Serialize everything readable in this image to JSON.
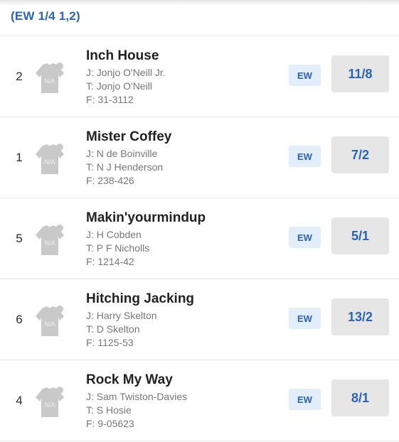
{
  "market": {
    "each_way_terms": "(EW 1/4 1,2)"
  },
  "colors": {
    "accent": "#2a63b7",
    "ew_bg": "#e2eef9",
    "odds_bg": "#e6e6e6",
    "silk": "#c7c7c7"
  },
  "runners": [
    {
      "number": "2",
      "name": "Inch House",
      "jockey": "J: Jonjo O'Neill Jr.",
      "trainer": "T: Jonjo O'Neill",
      "form": "F: 31-3112",
      "silk_label": "N/A",
      "ew_label": "EW",
      "odds": "11/8"
    },
    {
      "number": "1",
      "name": "Mister Coffey",
      "jockey": "J: N de Boinville",
      "trainer": "T: N J Henderson",
      "form": "F: 238-426",
      "silk_label": "N/A",
      "ew_label": "EW",
      "odds": "7/2"
    },
    {
      "number": "5",
      "name": "Makin'yourmindup",
      "jockey": "J: H Cobden",
      "trainer": "T: P F Nicholls",
      "form": "F: 1214-42",
      "silk_label": "N/A",
      "ew_label": "EW",
      "odds": "5/1"
    },
    {
      "number": "6",
      "name": "Hitching Jacking",
      "jockey": "J: Harry Skelton",
      "trainer": "T: D Skelton",
      "form": "F: 1125-53",
      "silk_label": "N/A",
      "ew_label": "EW",
      "odds": "13/2"
    },
    {
      "number": "4",
      "name": "Rock My Way",
      "jockey": "J: Sam Twiston-Davies",
      "trainer": "T: S Hosie",
      "form": "F: 9-05623",
      "silk_label": "N/A",
      "ew_label": "EW",
      "odds": "8/1"
    }
  ]
}
